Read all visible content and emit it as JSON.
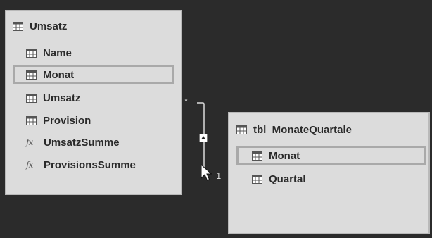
{
  "tables": [
    {
      "name": "Umsatz",
      "fields": [
        {
          "label": "Name",
          "icon": "table-column-icon"
        },
        {
          "label": "Monat",
          "icon": "table-column-icon",
          "selected": true
        },
        {
          "label": "Umsatz",
          "icon": "table-column-icon"
        },
        {
          "label": "Provision",
          "icon": "table-column-icon"
        },
        {
          "label": "UmsatzSumme",
          "icon": "measure-icon"
        },
        {
          "label": "ProvisionsSumme",
          "icon": "measure-icon"
        }
      ]
    },
    {
      "name": "tbl_MonateQuartale",
      "fields": [
        {
          "label": "Monat",
          "icon": "table-column-icon",
          "selected": true
        },
        {
          "label": "Quartal",
          "icon": "table-column-icon"
        }
      ]
    }
  ],
  "relationship": {
    "from_cardinality": "*",
    "to_cardinality": "1",
    "direction_icon": "arrow-up-icon"
  },
  "measure_icon_glyph": "fx"
}
